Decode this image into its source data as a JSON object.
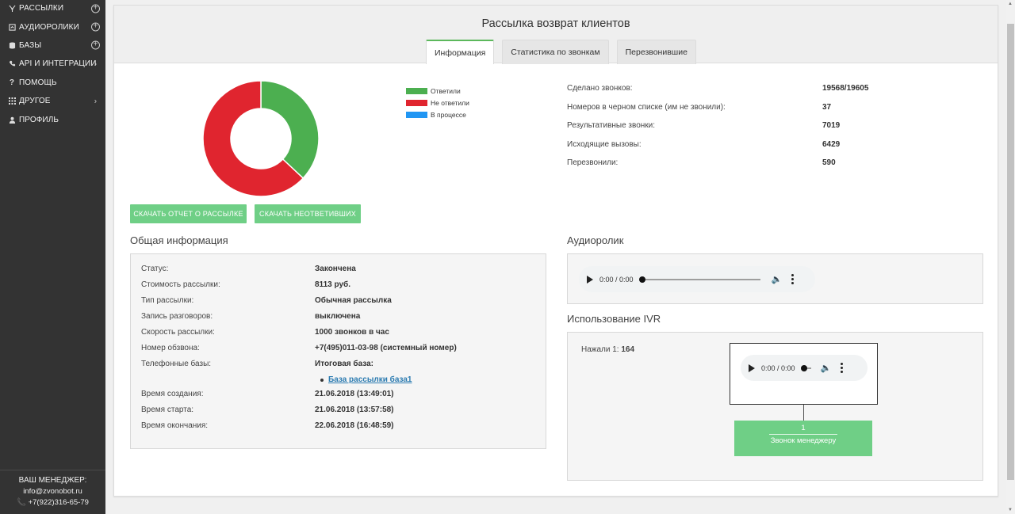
{
  "sidebar": {
    "items": [
      {
        "label": "РАССЫЛКИ",
        "icon": "broadcast-icon",
        "action": "plus"
      },
      {
        "label": "АУДИОРОЛИКИ",
        "icon": "audio-file-icon",
        "action": "plus"
      },
      {
        "label": "БАЗЫ",
        "icon": "database-icon",
        "action": "plus"
      },
      {
        "label": "API И ИНТЕГРАЦИИ",
        "icon": "phone-api-icon",
        "action": "chevron"
      },
      {
        "label": "ПОМОЩЬ",
        "icon": "help-icon",
        "action": ""
      },
      {
        "label": "ДРУГОЕ",
        "icon": "grid-icon",
        "action": "chevron"
      },
      {
        "label": "ПРОФИЛЬ",
        "icon": "user-icon",
        "action": ""
      }
    ],
    "manager": {
      "title": "ВАШ МЕНЕДЖЕР:",
      "email": "info@zvonobot.ru",
      "phone": "+7(922)316-65-79"
    }
  },
  "header": {
    "title": "Рассылка возврат клиентов",
    "tabs": [
      "Информация",
      "Статистика по звонкам",
      "Перезвонившие"
    ]
  },
  "chart_data": {
    "type": "pie",
    "categories": [
      "Ответили",
      "Не ответили",
      "В процессе"
    ],
    "values": [
      37,
      63,
      0
    ],
    "colors": [
      "#4caf50",
      "#e0252f",
      "#2196f3"
    ],
    "legend": "top-right"
  },
  "buttons": {
    "report": "СКАЧАТЬ ОТЧЕТ О РАССЫЛКЕ",
    "unanswered": "СКАЧАТЬ НЕОТВЕТИВШИХ"
  },
  "stats": [
    {
      "label": "Сделано звонков:",
      "value": "19568/19605"
    },
    {
      "label": "Номеров в черном списке (им не звонили):",
      "value": "37"
    },
    {
      "label": "Результативные звонки:",
      "value": "7019"
    },
    {
      "label": "Исходящие вызовы:",
      "value": "6429"
    },
    {
      "label": "Перезвонили:",
      "value": "590"
    }
  ],
  "general": {
    "title": "Общая информация",
    "rows": [
      {
        "label": "Статус:",
        "value": "Закончена"
      },
      {
        "label": "Стоимость рассылки:",
        "value": "8113 руб."
      },
      {
        "label": "Тип рассылки:",
        "value": "Обычная рассылка"
      },
      {
        "label": "Запись разговоров:",
        "value": "выключена"
      },
      {
        "label": "Скорость рассылки:",
        "value": "1000 звонков в час"
      },
      {
        "label": "Номер обзвона:",
        "value": "+7(495)011-03-98 (системный номер)"
      },
      {
        "label": "Телефонные базы:",
        "value": "Итоговая база:"
      },
      {
        "label": "Время создания:",
        "value": "21.06.2018 (13:49:01)"
      },
      {
        "label": "Время старта:",
        "value": "21.06.2018 (13:57:58)"
      },
      {
        "label": "Время окончания:",
        "value": "22.06.2018 (16:48:59)"
      }
    ],
    "base_link": "База рассылки база1"
  },
  "audio": {
    "title": "Аудиоролик",
    "time": "0:00 / 0:00"
  },
  "ivr": {
    "title": "Использование IVR",
    "pressed_label": "Нажали 1:",
    "pressed_value": "164",
    "time": "0:00 / 0:00",
    "node_key": "1",
    "node_label": "Звонок менеджеру"
  },
  "colors": {
    "sidebar": "#333333",
    "accent": "#6fcf86",
    "answered": "#4caf50",
    "not_answered": "#e0252f",
    "in_progress": "#2196f3"
  }
}
